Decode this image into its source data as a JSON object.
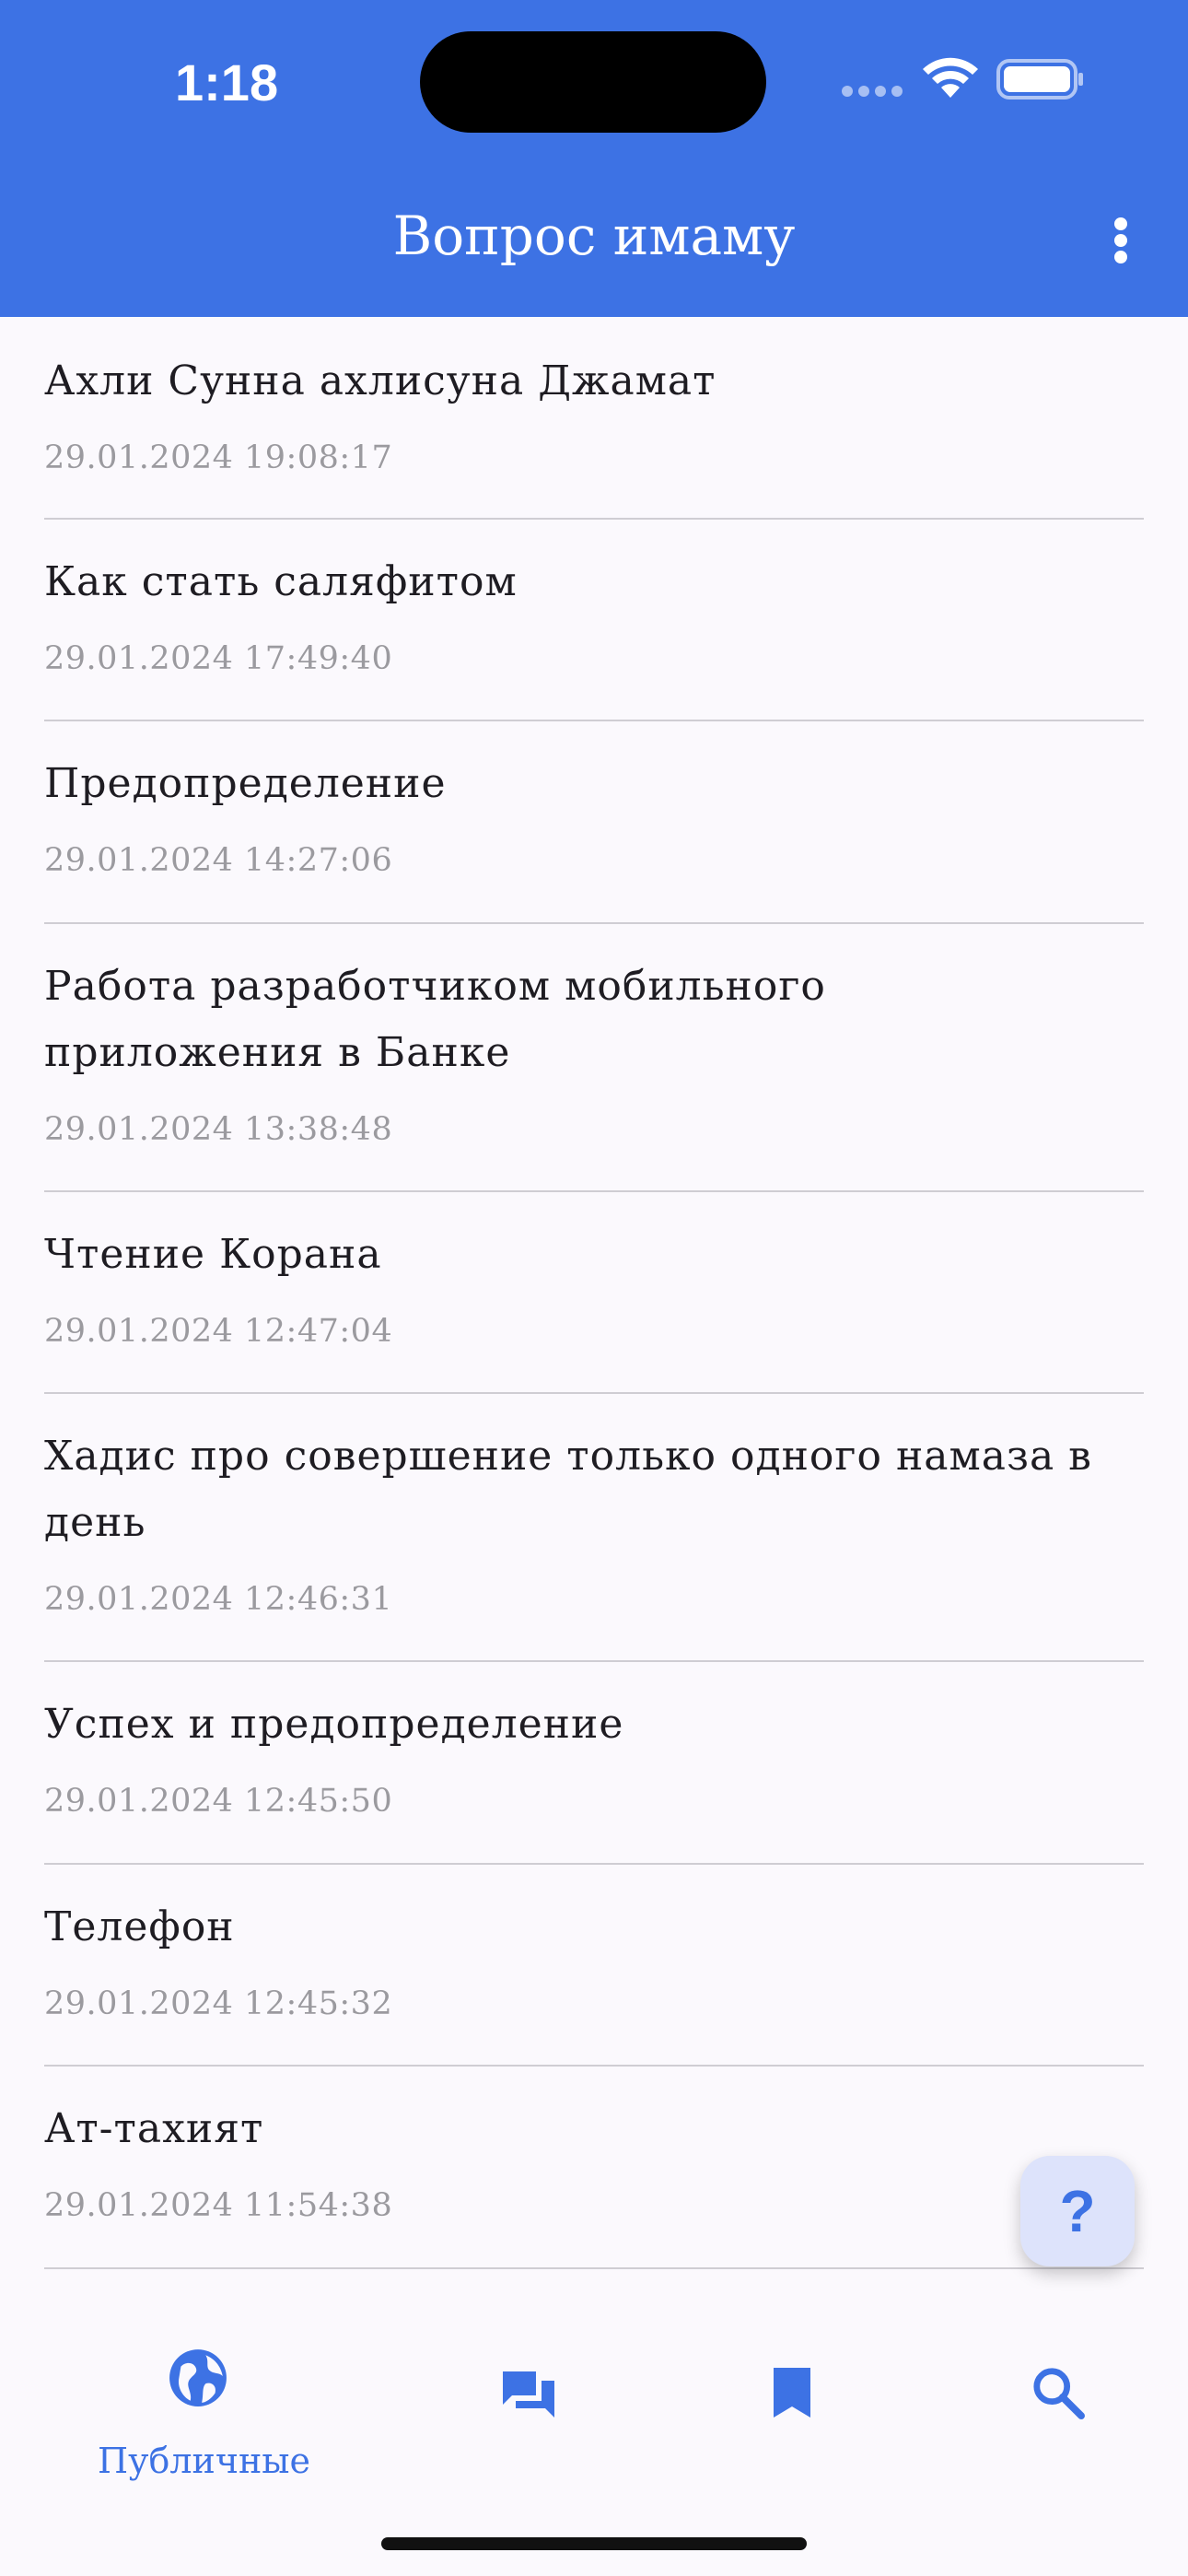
{
  "status_bar": {
    "time": "1:18"
  },
  "app_bar": {
    "title": "Вопрос имаму",
    "menu_icon": "more-vert-icon"
  },
  "questions": [
    {
      "title": "Ахли Сунна ахлисуна Джамат",
      "date": "29.01.2024 19:08:17"
    },
    {
      "title": "Как стать саляфитом",
      "date": "29.01.2024 17:49:40"
    },
    {
      "title": "Предопределение",
      "date": "29.01.2024 14:27:06"
    },
    {
      "title_line1": "Работа разработчиком мобильного",
      "title_line2": "приложения в Банке",
      "date": "29.01.2024 13:38:48"
    },
    {
      "title": "Чтение Корана",
      "date": "29.01.2024 12:47:04"
    },
    {
      "title_line1": "Хадис про совершение только одного намаза в",
      "title_line2": "день",
      "date": "29.01.2024 12:46:31"
    },
    {
      "title": "Успех и предопределение",
      "date": "29.01.2024 12:45:50"
    },
    {
      "title": "Телефон",
      "date": "29.01.2024 12:45:32"
    },
    {
      "title": "Ат-тахият",
      "date": "29.01.2024 11:54:38"
    }
  ],
  "fab": {
    "label": "?",
    "icon": "help-icon"
  },
  "bottom_nav": {
    "items": [
      {
        "label": "Публичные",
        "icon": "globe-icon",
        "active": true
      },
      {
        "icon": "chat-icon"
      },
      {
        "icon": "bookmark-icon"
      },
      {
        "icon": "search-icon"
      }
    ]
  },
  "colors": {
    "primary": "#3d72e4",
    "background": "#fbf9fd",
    "date_text": "#9b9a9f",
    "fab_bg": "#dde3fb"
  }
}
